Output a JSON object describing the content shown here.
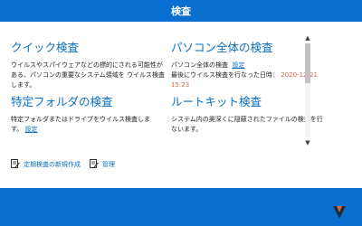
{
  "window": {
    "title": "検査"
  },
  "scans": [
    {
      "title": "クイック検査",
      "description": "ウイルスやスパイウェアなどの標的にされる可能性がある、パソコンの重要なシステム領域を ウイルス検査します。"
    },
    {
      "title": "パソコン全体の検査",
      "description": "パソコン全体の検査",
      "settings_link": "設定",
      "last_scan_label": "最後にウイルス検査を行なった日時：",
      "last_scan_date": "2020-12-21 15:23"
    },
    {
      "title": "特定フォルダの検査",
      "description": "特定フォルダまたはドライブをウイルス検査します。",
      "settings_link": "設定"
    },
    {
      "title": "ルートキット検査",
      "description": "システム内の奥深くに隠蔽されたファイルの検査を行ないます。"
    }
  ],
  "actions": {
    "new_schedule_label": "定期検査の新規作成",
    "manage_label": "管理"
  },
  "colors": {
    "accent_blue": "#0a6fd0",
    "link_blue": "#0b6fc2",
    "date_orange": "#e0623a"
  },
  "icons": {
    "new_schedule": "document-edit-icon",
    "manage": "document-edit-icon",
    "logo": "brand-logo-icon"
  }
}
